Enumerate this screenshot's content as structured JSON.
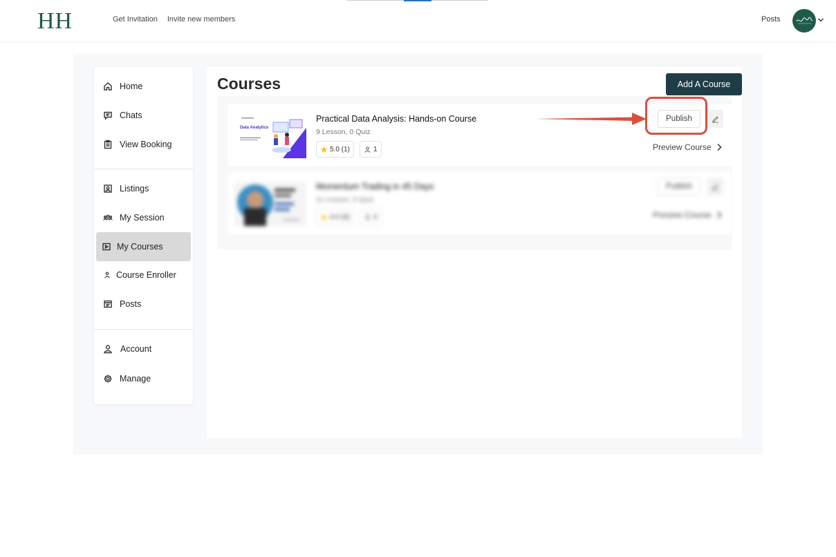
{
  "header": {
    "logo": "HH",
    "nav": [
      "Get Invitation",
      "Invite new members"
    ],
    "posts_label": "Posts"
  },
  "sidebar": {
    "groups": [
      [
        {
          "label": "Home",
          "icon": "home-icon"
        },
        {
          "label": "Chats",
          "icon": "chat-icon"
        },
        {
          "label": "View Booking",
          "icon": "clipboard-icon"
        }
      ],
      [
        {
          "label": "Listings",
          "icon": "listing-icon"
        },
        {
          "label": "My Session",
          "icon": "group-icon"
        },
        {
          "label": "My Courses",
          "icon": "play-square-icon",
          "active": true
        },
        {
          "label": "Course Enroller",
          "icon": "user-icon"
        },
        {
          "label": "Posts",
          "icon": "window-icon"
        }
      ],
      [
        {
          "label": "Account",
          "icon": "account-icon"
        },
        {
          "label": "Manage",
          "icon": "gear-icon"
        }
      ]
    ]
  },
  "main": {
    "title": "Courses",
    "add_button": "Add A Course",
    "courses": [
      {
        "title": "Practical Data Analysis: Hands-on Course",
        "meta": "9 Lesson, 0 Quiz",
        "rating": "5.0 (1)",
        "enrolled": "1",
        "publish_label": "Publish",
        "preview_label": "Preview Course",
        "thumb_heading": "Data Analytics"
      },
      {
        "title": "Momentum Trading in 45 Days",
        "meta": "11 Lesson, 0 Quiz",
        "rating": "0.0 (0)",
        "enrolled": "0",
        "publish_label": "Publish",
        "preview_label": "Preview Course"
      }
    ]
  },
  "colors": {
    "brand": "#1e5b4a",
    "add_button": "#1f3d47",
    "annotation": "#d9503c",
    "star": "#f5c518"
  }
}
